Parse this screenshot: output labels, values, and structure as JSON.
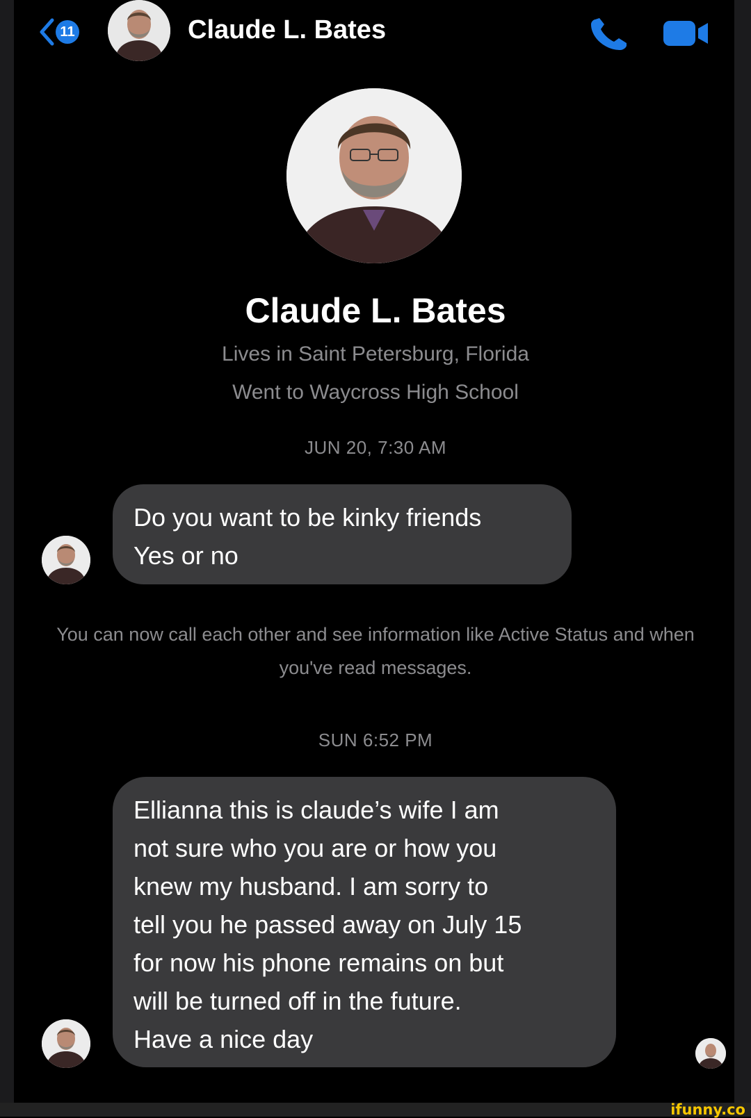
{
  "header": {
    "unread_count": "11",
    "contact_name": "Claude L. Bates"
  },
  "profile": {
    "name": "Claude L. Bates",
    "lives_in": "Lives in Saint Petersburg, Florida",
    "education": "Went to Waycross High School"
  },
  "messages": [
    {
      "timestamp": "JUN 20, 7:30 AM",
      "text": "Do you want to be kinky friends\nYes or no"
    },
    {
      "timestamp": "SUN 6:52 PM",
      "text": "Ellianna this is claude’s wife I am\nnot sure who you are or how you\nknew my husband.  I am sorry to\ntell you he passed away on July 15\nfor now his phone remains on but\nwill be turned off in the future.\nHave a nice day"
    }
  ],
  "system_message": "You can now call each other and see information like Active Status and when you've read messages.",
  "watermark": "ifunny.co",
  "colors": {
    "accent": "#1e7be6",
    "background": "#000000",
    "bubble": "#3a3a3c",
    "secondary_text": "#8c8c8f",
    "watermark": "#f6c600"
  },
  "icons": {
    "back": "chevron-left-icon",
    "call": "phone-icon",
    "video": "video-camera-icon"
  }
}
